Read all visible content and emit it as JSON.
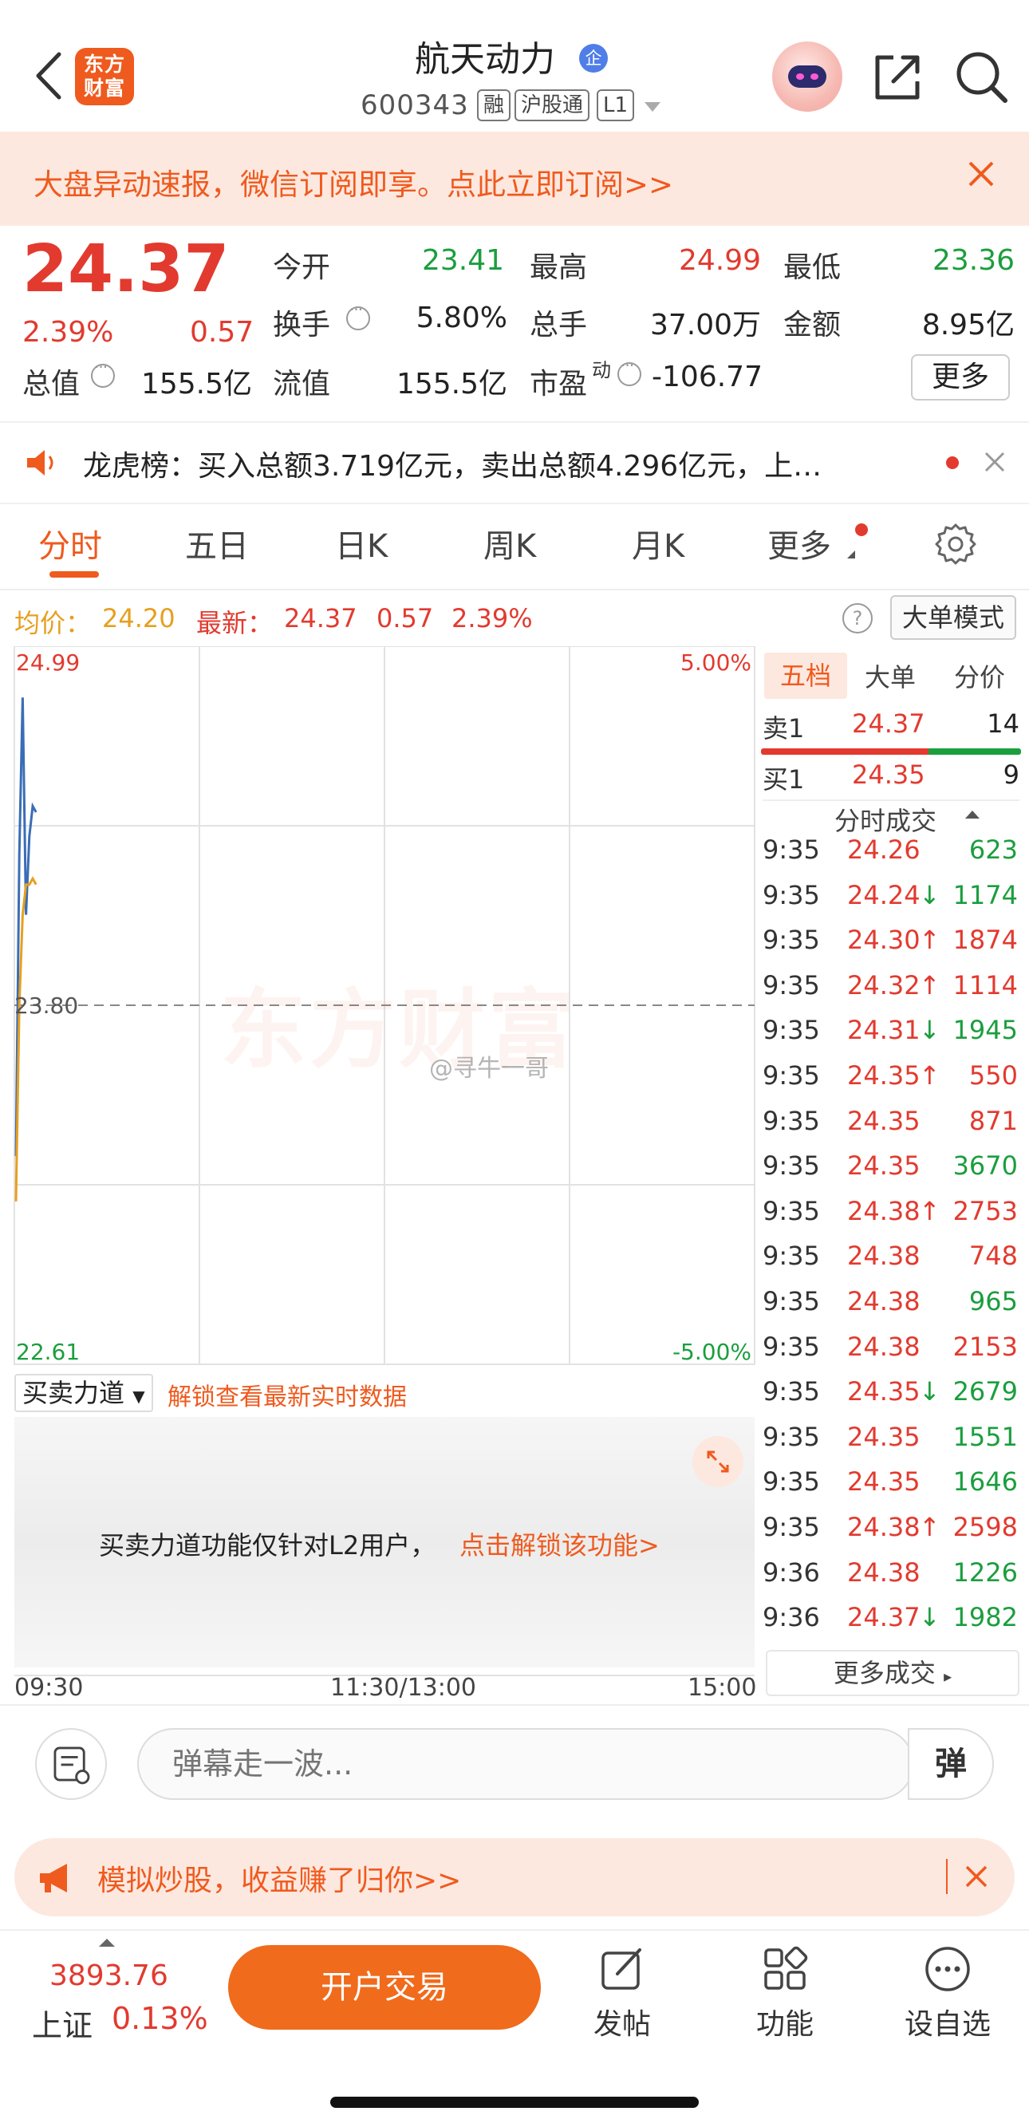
{
  "header": {
    "stock_name": "航天动力",
    "enterprise_badge": "企",
    "stock_code": "600343",
    "tags": [
      "融",
      "沪股通",
      "L1"
    ],
    "app_logo": "东方\n财富",
    "icons": [
      "back-arrow-icon",
      "robot-avatar-icon",
      "share-icon",
      "search-icon"
    ]
  },
  "subscribe_banner": {
    "text": "大盘异动速报，微信订阅即享。点此立即订阅>>"
  },
  "quote": {
    "last_price": "24.37",
    "change_pct": "2.39%",
    "change_amt": "0.57",
    "fields": {
      "open_label": "今开",
      "open_value": "23.41",
      "high_label": "最高",
      "high_value": "24.99",
      "low_label": "最低",
      "low_value": "23.36",
      "turnover_label": "换手",
      "turnover_value": "5.80%",
      "volume_label": "总手",
      "volume_value": "37.00万",
      "amount_label": "金额",
      "amount_value": "8.95亿",
      "total_mv_label": "总值",
      "total_mv_value": "155.5亿",
      "float_mv_label": "流值",
      "float_mv_value": "155.5亿",
      "pe_label": "市盈",
      "pe_sup": "动",
      "pe_value": "-106.77"
    },
    "more_button": "更多"
  },
  "dragon_tiger": {
    "text": "龙虎榜：买入总额3.719亿元，卖出总额4.296亿元，上…"
  },
  "tabs": {
    "items": [
      "分时",
      "五日",
      "日K",
      "周K",
      "月K",
      "更多"
    ],
    "active": "分时"
  },
  "info_line": {
    "avg_label": "均价：",
    "avg_value": "24.20",
    "latest_label": "最新：",
    "latest_value": "24.37",
    "latest_change": "0.57",
    "latest_pct": "2.39%",
    "help": "?",
    "big_order_mode": "大单模式"
  },
  "chart_data": {
    "type": "line",
    "y_top_label": "24.99",
    "y_mid_label": "23.80",
    "y_bottom_label": "22.61",
    "pct_top_label": "5.00%",
    "pct_bottom_label": "-5.00%",
    "ylim": [
      22.61,
      24.99
    ],
    "prev_close": 23.8,
    "x_labels": [
      "09:30",
      "11:30/13:00",
      "15:00"
    ],
    "watermark": "东方财富",
    "weibo_tag": "@寻牛一哥",
    "series": [
      {
        "color": "#3a6db5",
        "x": [
          0,
          1,
          2,
          3,
          4,
          5,
          6
        ],
        "y": [
          23.3,
          24.3,
          24.82,
          24.1,
          24.36,
          24.46,
          24.44
        ]
      },
      {
        "color": "#e6a01f",
        "x": [
          0,
          1,
          2,
          3,
          4,
          5,
          6
        ],
        "y": [
          23.15,
          23.8,
          24.1,
          24.2,
          24.2,
          24.22,
          24.2
        ]
      }
    ]
  },
  "force": {
    "select_label": "买卖力道",
    "unlock_link": "解锁查看最新实时数据",
    "l2_text": "买卖力道功能仅针对L2用户，",
    "l2_link": "点击解锁该功能>"
  },
  "order_book": {
    "tabs": [
      "五档",
      "大单",
      "分价"
    ],
    "sell1": {
      "label": "卖1",
      "price": "24.37",
      "volume": "14"
    },
    "buy1": {
      "label": "买1",
      "price": "24.35",
      "volume": "9"
    },
    "trades_title": "分时成交",
    "trades": [
      {
        "time": "9:35",
        "price": "24.26",
        "arrow": "",
        "vol": "623",
        "side": "buy"
      },
      {
        "time": "9:35",
        "price": "24.24",
        "arrow": "↓",
        "vol": "1174",
        "side": "buy"
      },
      {
        "time": "9:35",
        "price": "24.30",
        "arrow": "↑",
        "vol": "1874",
        "side": "sell"
      },
      {
        "time": "9:35",
        "price": "24.32",
        "arrow": "↑",
        "vol": "1114",
        "side": "sell"
      },
      {
        "time": "9:35",
        "price": "24.31",
        "arrow": "↓",
        "vol": "1945",
        "side": "buy"
      },
      {
        "time": "9:35",
        "price": "24.35",
        "arrow": "↑",
        "vol": "550",
        "side": "sell"
      },
      {
        "time": "9:35",
        "price": "24.35",
        "arrow": "",
        "vol": "871",
        "side": "sell"
      },
      {
        "time": "9:35",
        "price": "24.35",
        "arrow": "",
        "vol": "3670",
        "side": "buy"
      },
      {
        "time": "9:35",
        "price": "24.38",
        "arrow": "↑",
        "vol": "2753",
        "side": "sell"
      },
      {
        "time": "9:35",
        "price": "24.38",
        "arrow": "",
        "vol": "748",
        "side": "sell"
      },
      {
        "time": "9:35",
        "price": "24.38",
        "arrow": "",
        "vol": "965",
        "side": "buy"
      },
      {
        "time": "9:35",
        "price": "24.38",
        "arrow": "",
        "vol": "2153",
        "side": "sell"
      },
      {
        "time": "9:35",
        "price": "24.35",
        "arrow": "↓",
        "vol": "2679",
        "side": "buy"
      },
      {
        "time": "9:35",
        "price": "24.35",
        "arrow": "",
        "vol": "1551",
        "side": "buy"
      },
      {
        "time": "9:35",
        "price": "24.35",
        "arrow": "",
        "vol": "1646",
        "side": "buy"
      },
      {
        "time": "9:35",
        "price": "24.38",
        "arrow": "↑",
        "vol": "2598",
        "side": "sell"
      },
      {
        "time": "9:36",
        "price": "24.38",
        "arrow": "",
        "vol": "1226",
        "side": "buy"
      },
      {
        "time": "9:36",
        "price": "24.37",
        "arrow": "↓",
        "vol": "1982",
        "side": "buy"
      }
    ],
    "more_trades": "更多成交"
  },
  "danmaku": {
    "placeholder": "弹幕走一波...",
    "send_label": "弹"
  },
  "promo": {
    "text": "模拟炒股，收益赚了归你>>"
  },
  "bottom_bar": {
    "index_value": "3893.76",
    "index_name": "上证",
    "index_pct": "0.13%",
    "open_trade": "开户交易",
    "nav": [
      {
        "label": "发帖",
        "icon": "edit-post-icon"
      },
      {
        "label": "功能",
        "icon": "grid-apps-icon"
      },
      {
        "label": "设自选",
        "icon": "more-dots-icon"
      }
    ]
  },
  "colors": {
    "accent": "#ef5a1e",
    "up": "#e23a2f",
    "down": "#1b9e3e",
    "avg_line": "#e6a01f",
    "price_line": "#3a6db5"
  }
}
